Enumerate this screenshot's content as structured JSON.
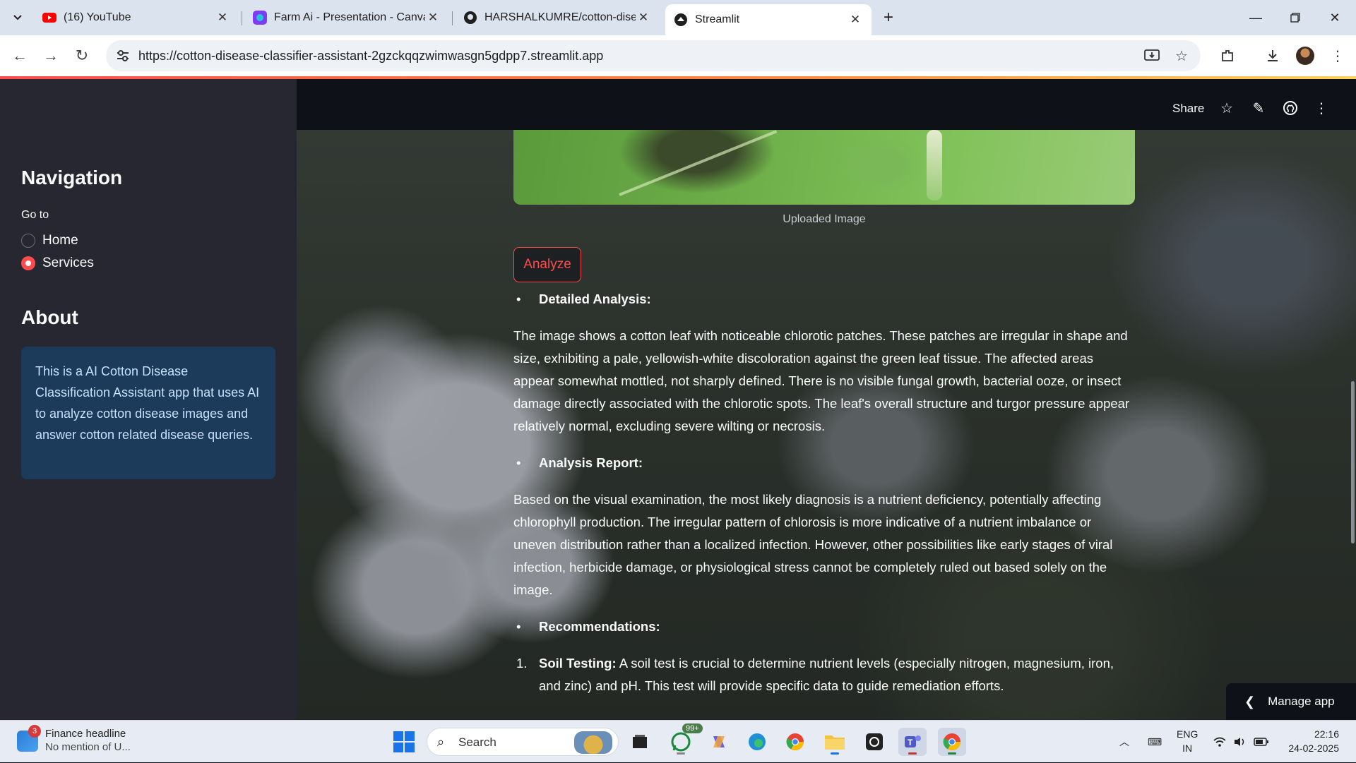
{
  "browser": {
    "tabs": [
      {
        "title": "(16) YouTube",
        "icon": "youtube-icon",
        "active": false
      },
      {
        "title": "Farm Ai - Presentation - Canva",
        "icon": "canva-icon",
        "active": false
      },
      {
        "title": "HARSHALKUMRE/cotton-diseas",
        "icon": "github-icon",
        "active": false
      },
      {
        "title": "Streamlit",
        "icon": "streamlit-icon",
        "active": true
      }
    ],
    "url": "https://cotton-disease-classifier-assistant-2gzckqqzwimwasgn5gdpp7.streamlit.app"
  },
  "app_header": {
    "share_label": "Share"
  },
  "sidebar": {
    "title": "Navigation",
    "goto_label": "Go to",
    "options": [
      {
        "label": "Home",
        "selected": false
      },
      {
        "label": "Services",
        "selected": true
      }
    ],
    "about_title": "About",
    "about_text": "This is a AI Cotton Disease Classification Assistant app that uses AI to analyze cotton disease images and answer cotton related disease queries."
  },
  "main": {
    "image_caption": "Uploaded Image",
    "analyze_label": "Analyze",
    "sections": {
      "detailed_heading": "Detailed Analysis:",
      "detailed_text": "The image shows a cotton leaf with noticeable chlorotic patches. These patches are irregular in shape and size, exhibiting a pale, yellowish-white discoloration against the green leaf tissue. The affected areas appear somewhat mottled, not sharply defined. There is no visible fungal growth, bacterial ooze, or insect damage directly associated with the chlorotic spots. The leaf's overall structure and turgor pressure appear relatively normal, excluding severe wilting or necrosis.",
      "report_heading": "Analysis Report:",
      "report_text": "Based on the visual examination, the most likely diagnosis is a nutrient deficiency, potentially affecting chlorophyll production. The irregular pattern of chlorosis is more indicative of a nutrient imbalance or uneven distribution rather than a localized infection. However, other possibilities like early stages of viral infection, herbicide damage, or physiological stress cannot be completely ruled out based solely on the image.",
      "recommendations_heading": "Recommendations:",
      "rec1_num": "1.",
      "rec1_title": "Soil Testing:",
      "rec1_text": " A soil test is crucial to determine nutrient levels (especially nitrogen, magnesium, iron, and zinc) and pH. This test will provide specific data to guide remediation efforts."
    },
    "manage_app_label": "Manage app"
  },
  "taskbar": {
    "news_title": "Finance headline",
    "news_sub": "No mention of U...",
    "news_badge": "3",
    "search_label": "Search",
    "whatsapp_badge": "99+",
    "lang_top": "ENG",
    "lang_bottom": "IN",
    "time": "22:16",
    "date": "24-02-2025"
  },
  "colors": {
    "accent": "#ff4b4b",
    "sidebar_bg": "#262730",
    "app_bg": "#0e1117",
    "info_box": "#1c3a5a"
  }
}
